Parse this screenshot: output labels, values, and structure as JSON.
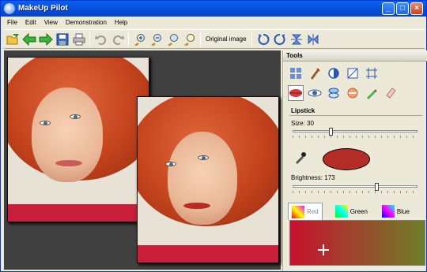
{
  "window": {
    "title": "MakeUp Pilot"
  },
  "menu": [
    "File",
    "Edit",
    "View",
    "Demonstration",
    "Help"
  ],
  "toolbar": {
    "icons": [
      "open-icon",
      "back-icon",
      "forward-icon",
      "save-icon",
      "print-icon",
      "undo-icon",
      "redo-icon",
      "zoom-in-icon",
      "zoom-out-icon",
      "zoom-fit-icon",
      "zoom-actual-icon",
      "rotate-left-icon",
      "rotate-right-icon",
      "flip-vertical-icon",
      "flip-horizontal-icon"
    ],
    "original_image_label": "Original image"
  },
  "tools": {
    "header": "Tools",
    "section": "Lipstick",
    "size_label": "Size: 30",
    "size_value": 30,
    "brightness_label": "Brightness: 173",
    "brightness_value": 173,
    "current_color": "#b42c26",
    "tabs": [
      "Red",
      "Green",
      "Blue"
    ],
    "selected_tab": "Red"
  },
  "colors": {
    "accent": "#0a62f0",
    "gradient_start": "#c8102e",
    "gradient_end": "#6e7f2a"
  }
}
